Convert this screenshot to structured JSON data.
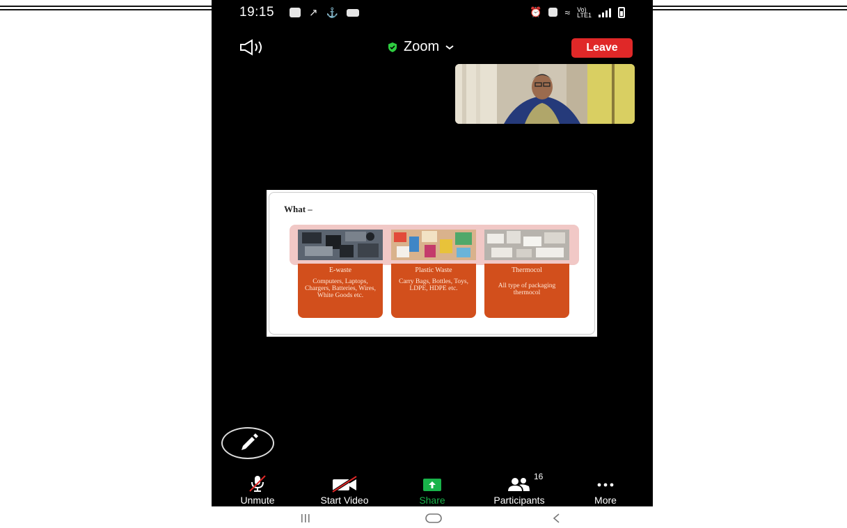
{
  "status_bar": {
    "time": "19:15"
  },
  "meeting_bar": {
    "title": "Zoom",
    "leave_label": "Leave"
  },
  "slide": {
    "title": "What –",
    "cards": [
      {
        "heading": "E-waste",
        "body": "Computers, Laptops, Chargers, Batteries, Wires, White Goods etc."
      },
      {
        "heading": "Plastic Waste",
        "body": "Carry Bags, Bottles, Toys, LDPE, HDPE etc."
      },
      {
        "heading": "Thermocol",
        "body": "All type of packaging thermocol"
      }
    ]
  },
  "toolbar": {
    "unmute_label": "Unmute",
    "start_video_label": "Start Video",
    "share_label": "Share",
    "participants_label": "Participants",
    "participants_count": "16",
    "more_label": "More"
  },
  "colors": {
    "leave": "#e02828",
    "share": "#19b34a",
    "security_shield": "#2ecc40",
    "card": "#d24f1c"
  }
}
